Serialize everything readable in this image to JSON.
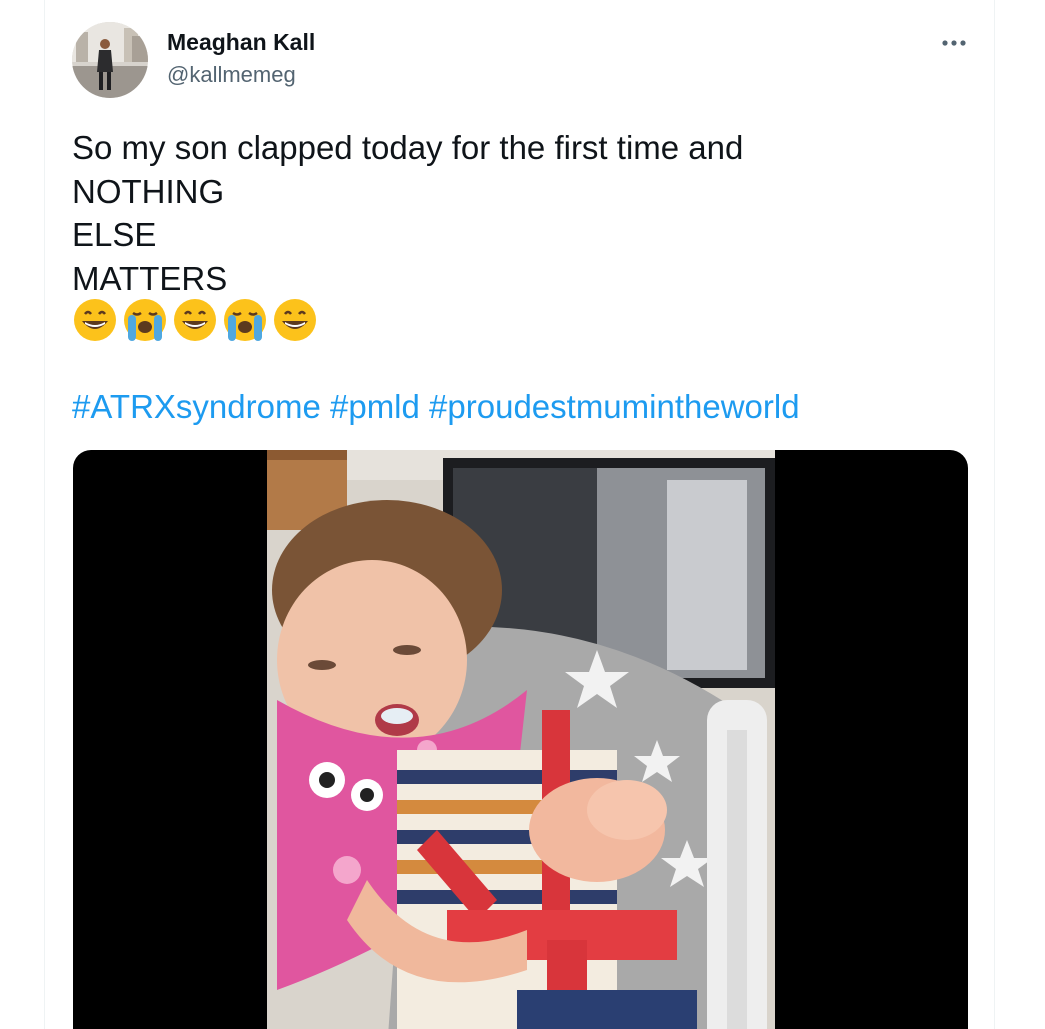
{
  "tweet": {
    "author": {
      "display_name": "Meaghan Kall",
      "handle": "@kallmemeg",
      "avatar_icon": "user-photo-avatar"
    },
    "more_icon": "more-options-icon",
    "text_lines": [
      "So my son clapped today for the first time and",
      "NOTHING",
      "ELSE",
      "MATTERS"
    ],
    "emojis": [
      "grinning-face",
      "loudly-crying-face",
      "grinning-face",
      "loudly-crying-face",
      "grinning-face"
    ],
    "hashtags": [
      "#ATRXsyndrome",
      "#pmld",
      "#proudestmumintheworld"
    ],
    "media": {
      "type": "video",
      "description_icon": "video-thumbnail"
    }
  },
  "colors": {
    "text": "#0f1419",
    "secondary": "#536471",
    "link": "#1d9bf0",
    "border": "#eff3f4"
  }
}
